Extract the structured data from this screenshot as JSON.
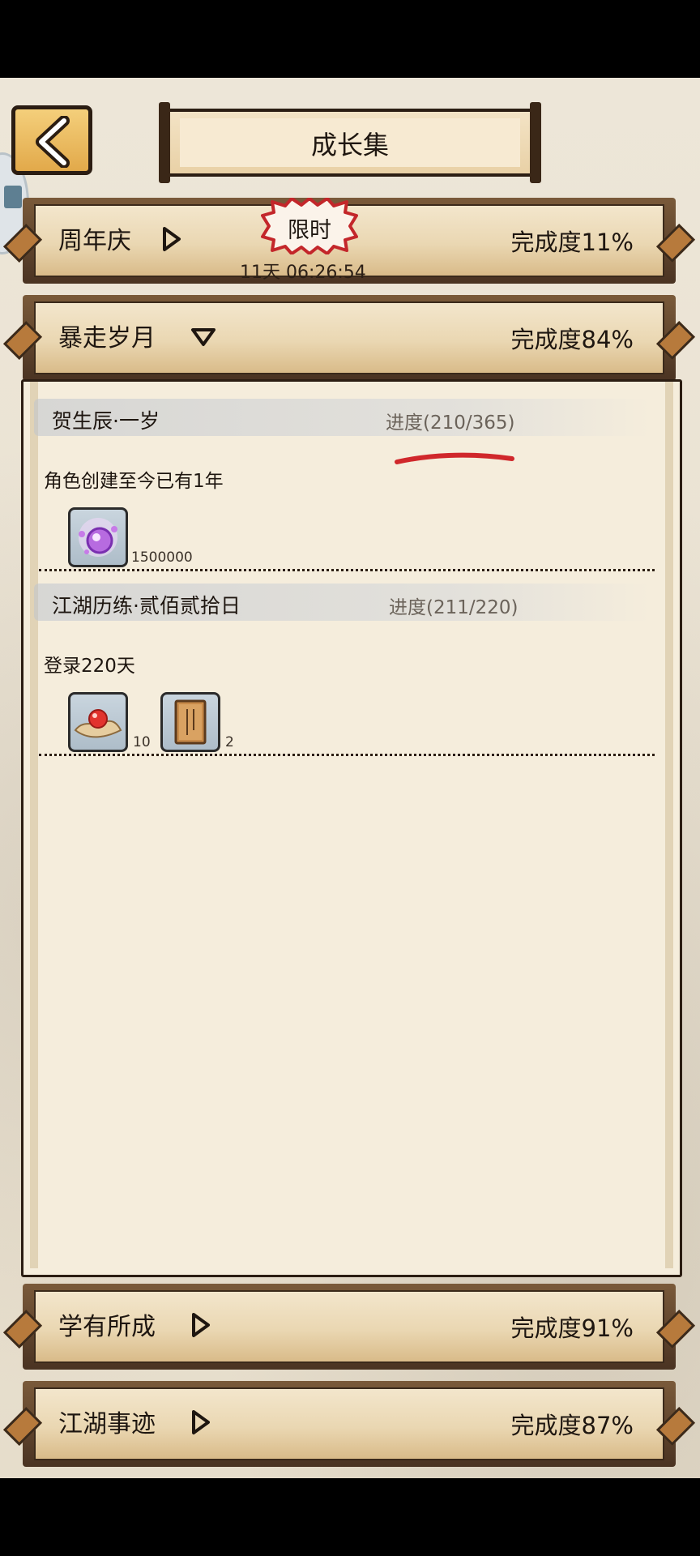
{
  "header": {
    "title": "成长集",
    "back_icon": "back-arrow-icon"
  },
  "categories": [
    {
      "label": "周年庆",
      "completion": "完成度11%",
      "badge": "限时",
      "countdown": "11天 06:26:54",
      "state": "collapsed"
    },
    {
      "label": "暴走岁月",
      "completion": "完成度84%",
      "state": "expanded"
    },
    {
      "label": "学有所成",
      "completion": "完成度91%",
      "state": "collapsed"
    },
    {
      "label": "江湖事迹",
      "completion": "完成度87%",
      "state": "collapsed"
    }
  ],
  "tasks": [
    {
      "name": "贺生辰·一岁",
      "progress": "进度(210/365)",
      "description": "角色创建至今已有1年",
      "rewards": [
        {
          "icon": "purple-orb-icon",
          "count": "1500000"
        }
      ]
    },
    {
      "name": "江湖历练·贰佰贰拾日",
      "progress": "进度(211/220)",
      "description": "登录220天",
      "rewards": [
        {
          "icon": "red-pearl-on-cloth-icon",
          "count": "10"
        },
        {
          "icon": "book-icon",
          "count": "2"
        }
      ]
    }
  ],
  "colors": {
    "accent_gold": "#e2a94a",
    "bar_brown": "#4a3322",
    "paper": "#f5eddc",
    "annotation_red": "#d0272b"
  }
}
